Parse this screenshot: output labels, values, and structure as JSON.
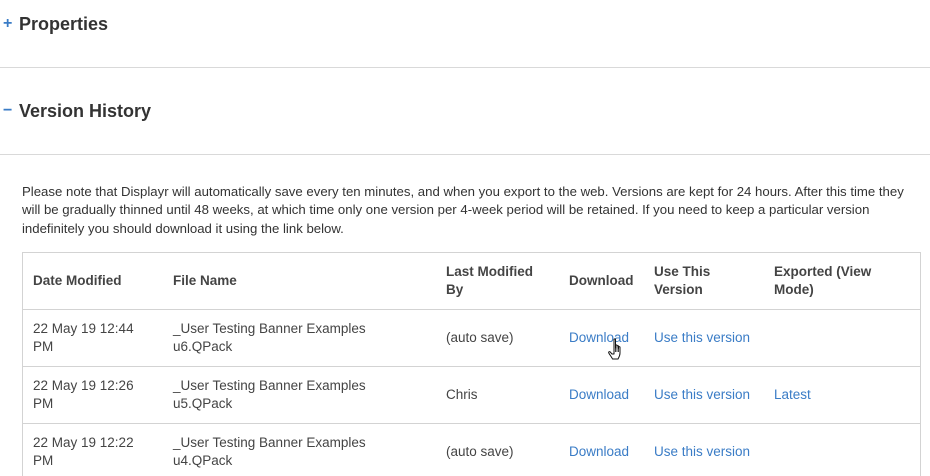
{
  "properties": {
    "toggle": "+",
    "title": "Properties"
  },
  "version_history": {
    "toggle": "−",
    "title": "Version History",
    "note": "Please note that Displayr will automatically save every ten minutes, and when you export to the web. Versions are kept for 24 hours. After this time they will be gradually thinned until 48 weeks, at which time only one version per 4-week period will be retained. If you need to keep a particular version indefinitely you should download it using the link below.",
    "columns": {
      "date": "Date Modified",
      "file": "File Name",
      "by": "Last Modified By",
      "download": "Download",
      "use": "Use This Version",
      "exported": "Exported (View Mode)"
    },
    "rows": [
      {
        "date": "22 May 19 12:44 PM",
        "file": "_User Testing Banner Examples u6.QPack",
        "by": "(auto save)",
        "download": "Download",
        "use": "Use this version",
        "exported": ""
      },
      {
        "date": "22 May 19 12:26 PM",
        "file": "_User Testing Banner Examples u5.QPack",
        "by": "Chris",
        "download": "Download",
        "use": "Use this version",
        "exported": "Latest"
      },
      {
        "date": "22 May 19 12:22 PM",
        "file": "_User Testing Banner Examples u4.QPack",
        "by": "(auto save)",
        "download": "Download",
        "use": "Use this version",
        "exported": ""
      }
    ]
  },
  "colors": {
    "link": "#3a7cc6",
    "divider": "#d9d9d9",
    "text": "#333333"
  },
  "icons": {
    "cursor": "hand-pointer-icon"
  }
}
